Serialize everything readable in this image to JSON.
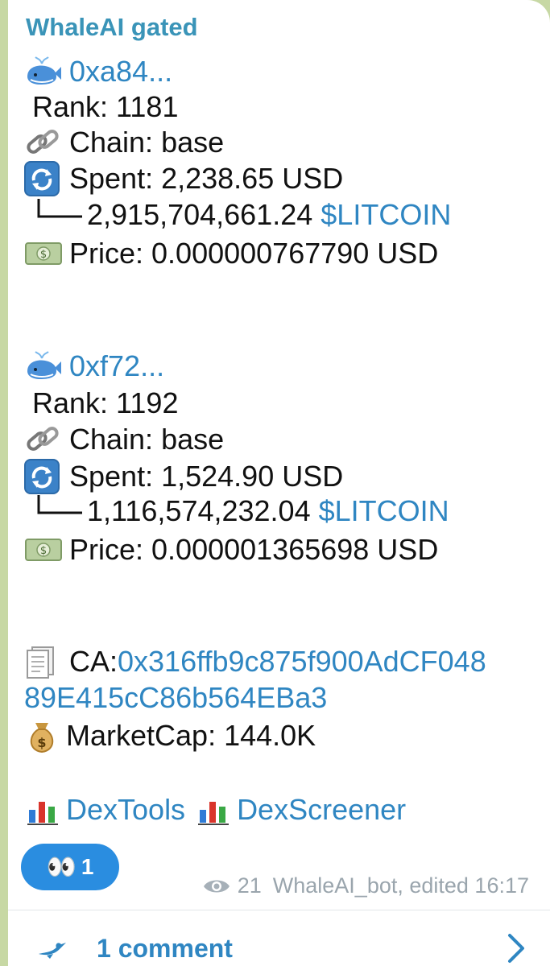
{
  "message": {
    "sender": "WhaleAI gated",
    "whales": [
      {
        "address": "0xa84...",
        "rank": "Rank: 1181",
        "chain": "Chain: base",
        "spent": "Spent: 2,238.65 USD",
        "amount": "2,915,704,661.24",
        "ticker": "$LITCOIN",
        "price": "Price: 0.000000767790 USD"
      },
      {
        "address": "0xf72...",
        "rank": "Rank: 1192",
        "chain": "Chain: base",
        "spent": "Spent: 1,524.90 USD",
        "amount": "1,116,574,232.04",
        "ticker": "$LITCOIN",
        "price": "Price: 0.000001365698 USD"
      }
    ],
    "ca_label": "CA: ",
    "ca_line1": "0x316ffb9c875f900AdCF048",
    "ca_line2": "89E415cC86b564EBa3",
    "marketcap": "MarketCap: 144.0K",
    "links": [
      "DexTools",
      "DexScreener"
    ]
  },
  "reaction": {
    "emoji": "👀",
    "count": "1"
  },
  "footer": {
    "views": "21",
    "author_edit": "WhaleAI_bot, edited 16:17"
  },
  "comments": {
    "label": "1 comment"
  },
  "colors": {
    "sender": "#3a94b8",
    "link": "#2f86c2",
    "reaction_bg": "#2a8de0",
    "meta": "#9aa5ad",
    "chat_bg": "#c7d8a4"
  },
  "icons": [
    "whale-icon",
    "link-icon",
    "refresh-icon",
    "money-icon",
    "document-icon",
    "money-bag-icon",
    "bar-chart-icon",
    "eye-icon",
    "bird-icon",
    "chevron-right-icon"
  ]
}
